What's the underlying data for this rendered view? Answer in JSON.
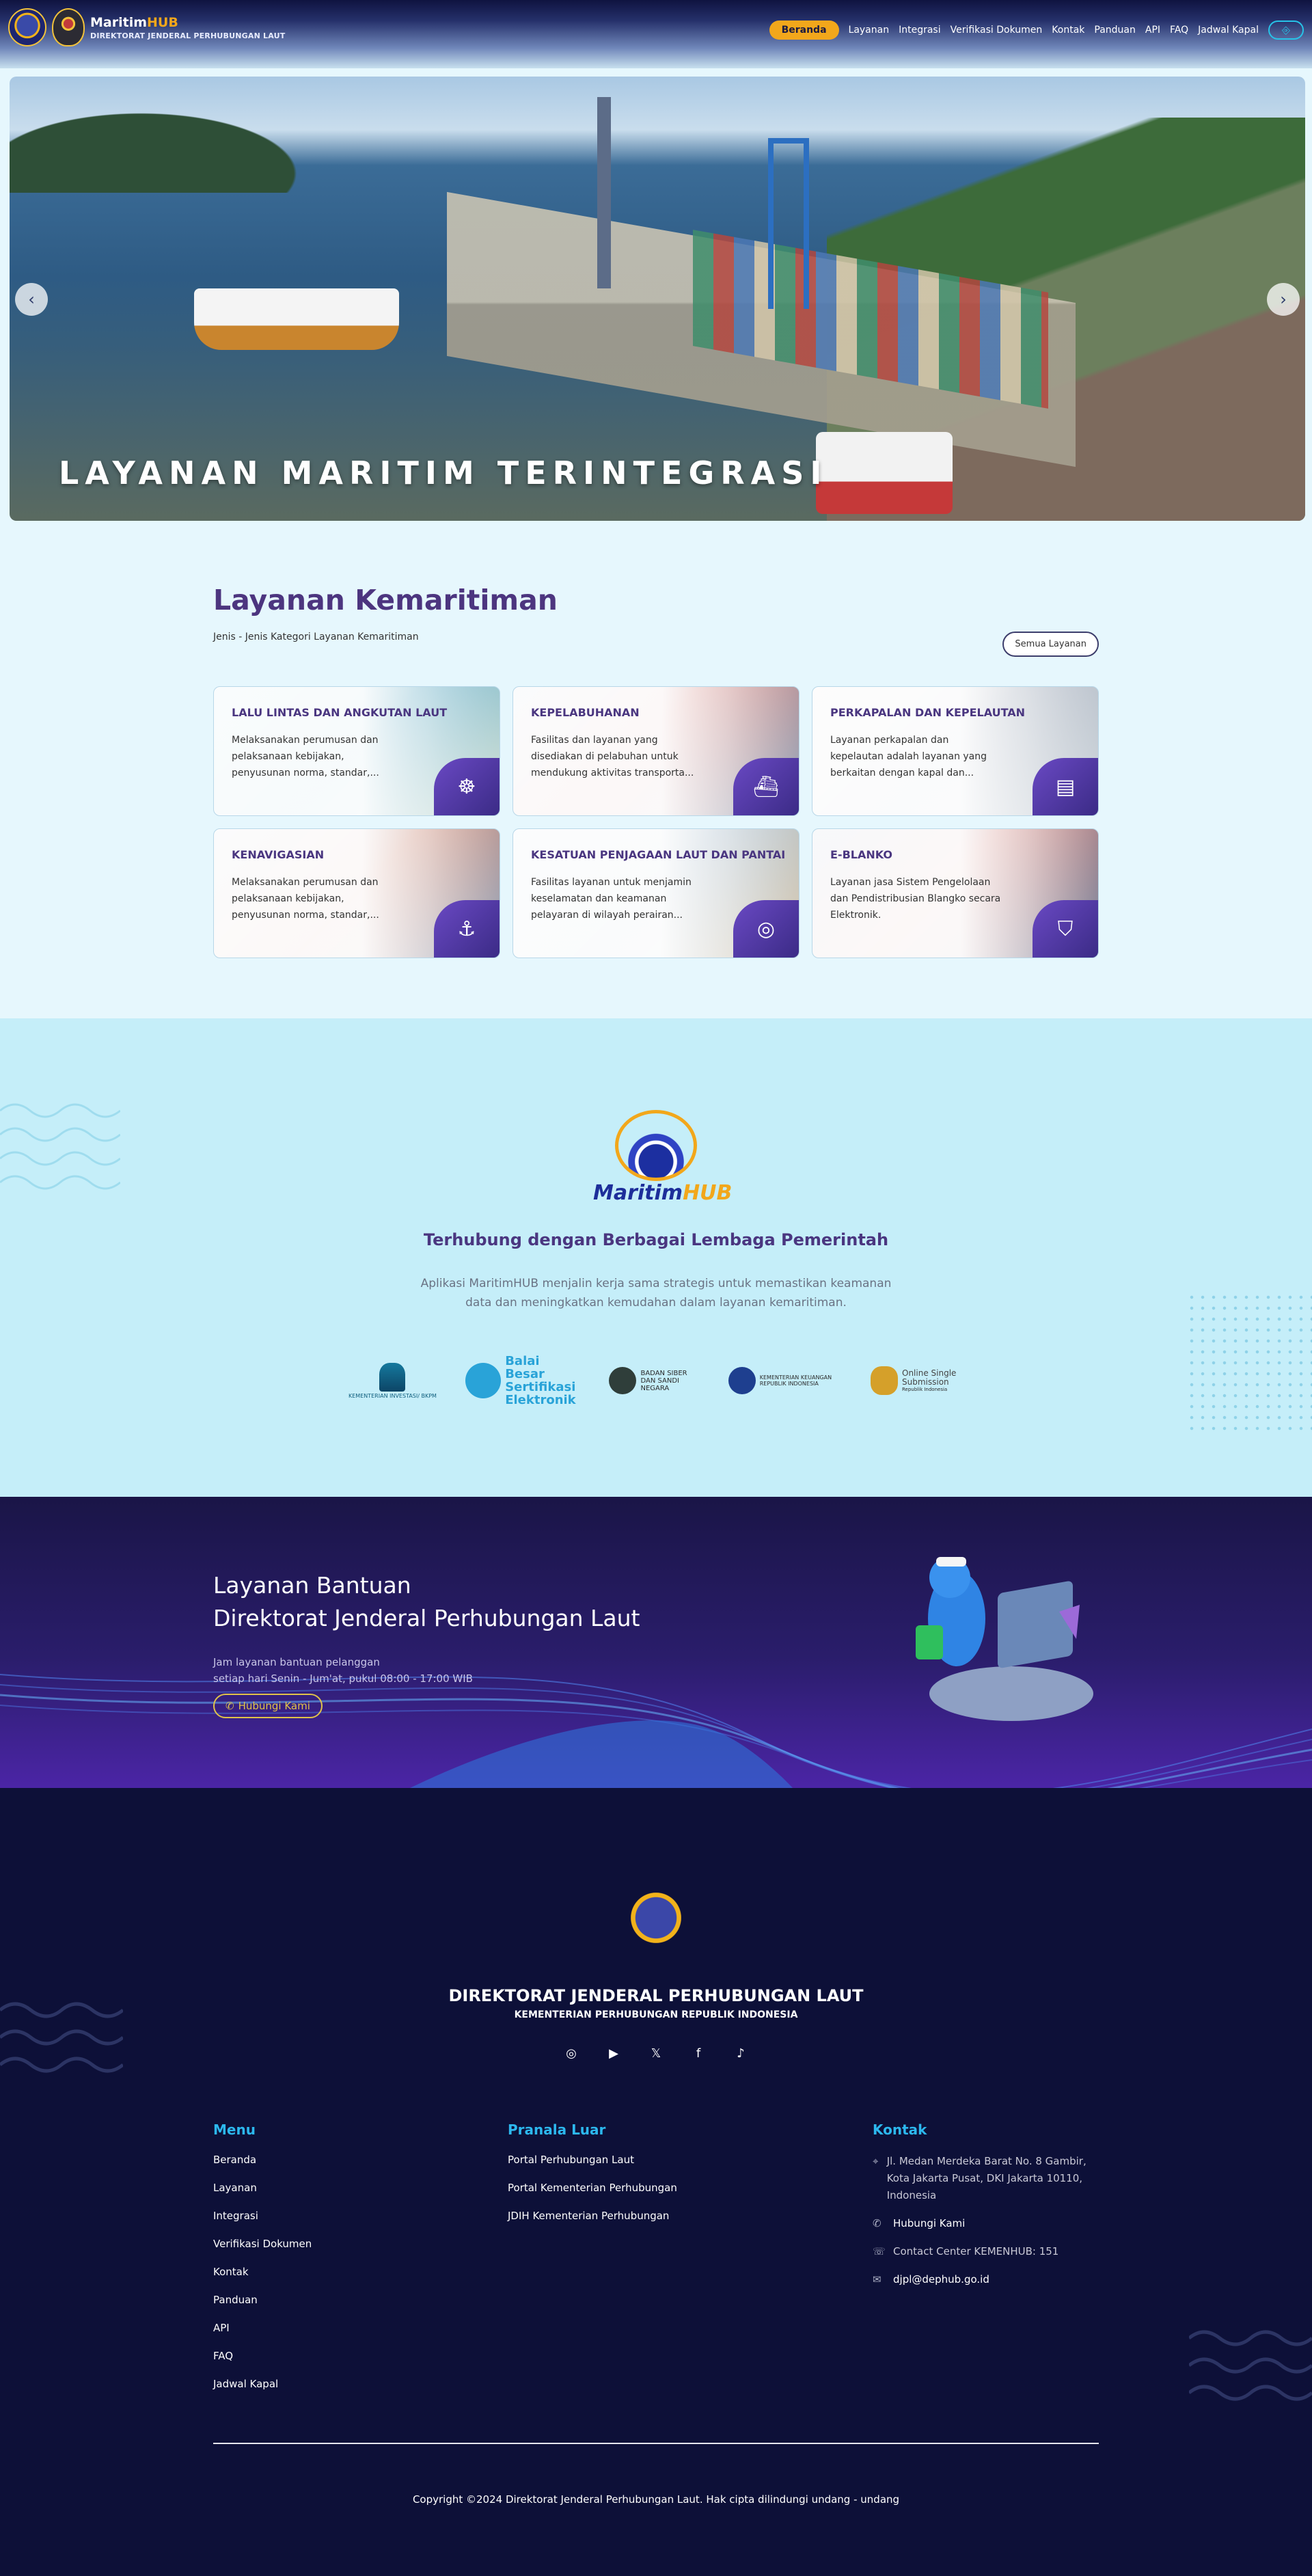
{
  "header": {
    "brand_name": "Maritim",
    "brand_name_accent": "HUB",
    "brand_subtitle": "DIREKTORAT JENDERAL PERHUBUNGAN LAUT",
    "nav": [
      "Beranda",
      "Layanan",
      "Integrasi",
      "Verifikasi Dokumen",
      "Kontak",
      "Panduan",
      "API",
      "FAQ",
      "Jadwal Kapal"
    ],
    "active_nav": "Beranda",
    "accent_color": "#f2a71b"
  },
  "hero": {
    "title": "LAYANAN MARITIM TERINTEGRASI",
    "prev_icon": "chevron-left-icon",
    "next_icon": "chevron-right-icon"
  },
  "services": {
    "title": "Layanan Kemaritiman",
    "subtitle": "Jenis - Jenis Kategori Layanan Kemaritiman",
    "all_button": "Semua Layanan",
    "cards": [
      {
        "title": "LALU LINTAS DAN ANGKUTAN LAUT",
        "desc": "Melaksanakan perumusan dan pelaksanaan kebijakan, penyusunan norma, standar,...",
        "icon": "ship-wheel-icon"
      },
      {
        "title": "KEPELABUHANAN",
        "desc": "Fasilitas dan layanan yang disediakan di pelabuhan untuk mendukung aktivitas transporta...",
        "icon": "port-crane-icon"
      },
      {
        "title": "PERKAPALAN DAN KEPELAUTAN",
        "desc": "Layanan perkapalan dan kepelautan adalah layanan yang berkaitan dengan kapal dan...",
        "icon": "certificate-icon"
      },
      {
        "title": "KENAVIGASIAN",
        "desc": "Melaksanakan perumusan dan pelaksanaan kebijakan, penyusunan norma, standar,...",
        "icon": "anchor-icon"
      },
      {
        "title": "KESATUAN PENJAGAAN LAUT DAN PANTAI",
        "desc": "Fasilitas layanan untuk menjamin keselamatan dan keamanan pelayaran di wilayah perairan...",
        "icon": "lifebuoy-icon"
      },
      {
        "title": "E-BLANKO",
        "desc": "Layanan jasa Sistem Pengelolaan dan Pendistribusian Blangko secara Elektronik.",
        "icon": "document-shield-icon"
      }
    ]
  },
  "partners": {
    "logo_word": "Maritim",
    "logo_accent": "HUB",
    "title": "Terhubung dengan Berbagai Lembaga Pemerintah",
    "description": "Aplikasi MaritimHUB menjalin kerja sama strategis untuk memastikan keamanan data dan meningkatkan kemudahan dalam layanan kemaritiman.",
    "logos": {
      "investasi": "KEMENTERIAN INVESTASI/ BKPM",
      "bsre": "Balai Besar Sertifikasi Elektronik",
      "bssn": "BADAN SIBER DAN SANDI NEGARA",
      "keuangan": "KEMENTERIAN KEUANGAN REPUBLIK INDONESIA",
      "oss": "Online Single Submission",
      "oss_sub": "Republik Indonesia"
    }
  },
  "support": {
    "line1": "Layanan Bantuan",
    "line2": "Direktorat Jenderal Perhubungan Laut",
    "hours1": "Jam layanan bantuan pelanggan",
    "hours2": "setiap hari Senin - Jum'at, pukul 08:00 - 17:00 WIB",
    "button": "Hubungi Kami"
  },
  "footer": {
    "title": "DIREKTORAT JENDERAL PERHUBUNGAN LAUT",
    "subtitle": "KEMENTERIAN PERHUBUNGAN REPUBLIK INDONESIA",
    "socials": [
      "instagram-icon",
      "youtube-icon",
      "x-icon",
      "facebook-icon",
      "tiktok-icon"
    ],
    "menu_title": "Menu",
    "menu": [
      "Beranda",
      "Layanan",
      "Integrasi",
      "Verifikasi Dokumen",
      "Kontak",
      "Panduan",
      "API",
      "FAQ",
      "Jadwal Kapal"
    ],
    "pranala_title": "Pranala Luar",
    "pranala": [
      "Portal Perhubungan Laut",
      "Portal Kementerian Perhubungan",
      "JDIH Kementerian Perhubungan"
    ],
    "kontak_title": "Kontak",
    "address": "Jl. Medan Merdeka Barat No. 8 Gambir, Kota Jakarta Pusat, DKI Jakarta 10110, Indonesia",
    "whatsapp": "Hubungi Kami",
    "contact_center": "Contact Center KEMENHUB: 151",
    "email": "djpl@dephub.go.id",
    "copyright": "Copyright ©2024 Direktorat Jenderal Perhubungan Laut. Hak cipta dilindungi undang - undang"
  }
}
